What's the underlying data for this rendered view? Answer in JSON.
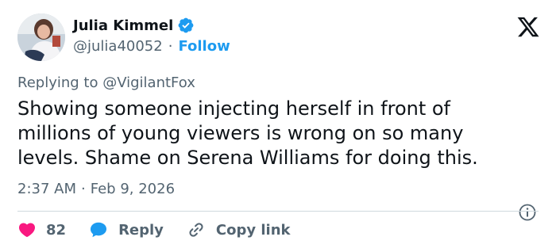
{
  "author": {
    "display_name": "Julia Kimmel",
    "handle": "@julia40052",
    "separator": "·",
    "follow_label": "Follow"
  },
  "tweet": {
    "replying_prefix": "Replying to ",
    "replying_to": "@VigilantFox",
    "text": "Showing someone injecting herself in front of millions of young viewers is wrong on so many levels. Shame on Serena Williams for doing this.",
    "time": "2:37 AM",
    "date": "Feb 9, 2026",
    "separator": "·"
  },
  "actions": {
    "like_count": "82",
    "reply_label": "Reply",
    "copy_label": "Copy link"
  },
  "icons": {
    "verified": "verified-badge-icon",
    "logo": "x-logo-icon",
    "info": "info-icon",
    "like": "heart-icon",
    "reply": "reply-bubble-icon",
    "copy": "link-icon"
  },
  "colors": {
    "accent": "#1d9bf0",
    "like": "#f91880",
    "text": "#0f1419",
    "muted": "#536471"
  }
}
